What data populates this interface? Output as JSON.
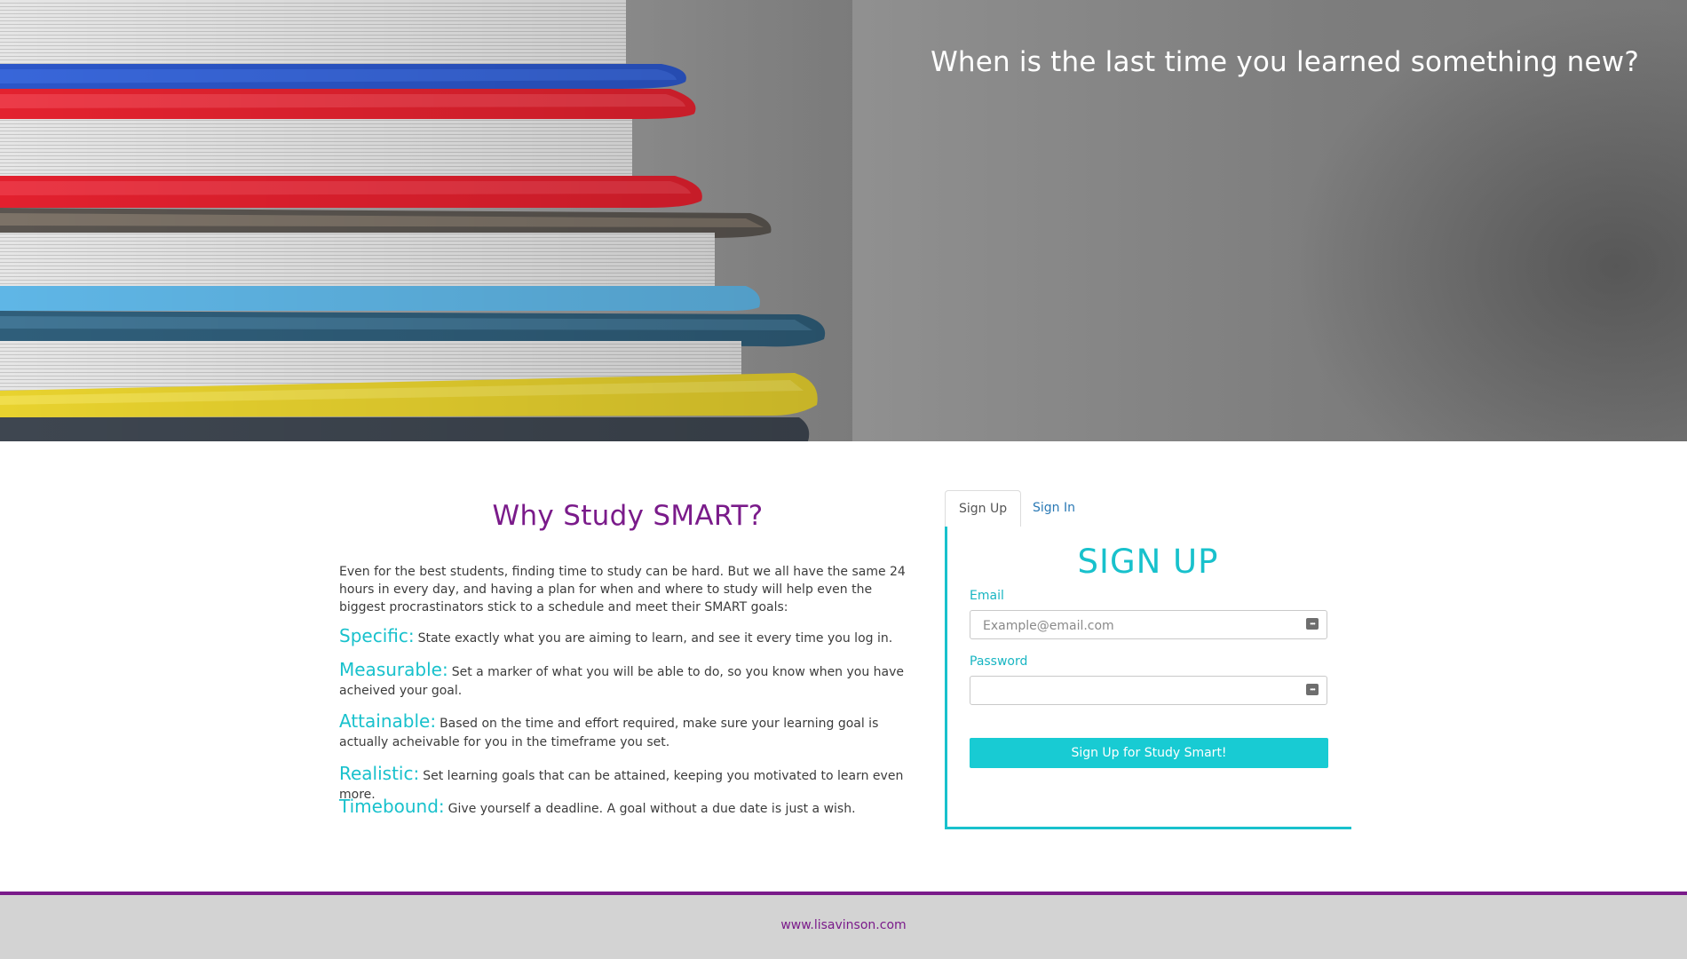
{
  "hero": {
    "tagline": "When is the last time you learned something new?"
  },
  "about": {
    "title": "Why Study SMART?",
    "intro": "Even for the best students, finding time to study can be hard. But we all have the same 24 hours in every day, and having a plan for when and where to study will help even the biggest procrastinators stick to a schedule and meet their SMART goals:",
    "goals": [
      {
        "term": "Specific:",
        "text": "State exactly what you are aiming to learn, and see it every time you log in."
      },
      {
        "term": "Measurable:",
        "text": "Set a marker of what you will be able to do, so you know when you have acheived your goal."
      },
      {
        "term": "Attainable:",
        "text": "Based on the time and effort required, make sure your learning goal is actually acheivable for you in the timeframe you set."
      },
      {
        "term": "Realistic:",
        "text": "Set learning goals that can be attained, keeping you motivated to learn even more."
      },
      {
        "term": "Timebound:",
        "text": "Give yourself a deadline. A goal without a due date is just a wish."
      }
    ]
  },
  "form": {
    "tabs": [
      "Sign Up",
      "Sign In"
    ],
    "heading": "SIGN UP",
    "email_label": "Email",
    "email_placeholder": "Example@email.com",
    "email_value": "",
    "password_label": "Password",
    "password_value": "",
    "submit_label": "Sign Up for Study Smart!"
  },
  "footer": {
    "link": "www.lisavinson.com"
  },
  "colors": {
    "brand_purple": "#7a1b8a",
    "accent_teal": "#18c1cc",
    "footer_bg": "#d3d3d3"
  },
  "icons": {
    "field_icon": "password-manager-key-icon"
  }
}
